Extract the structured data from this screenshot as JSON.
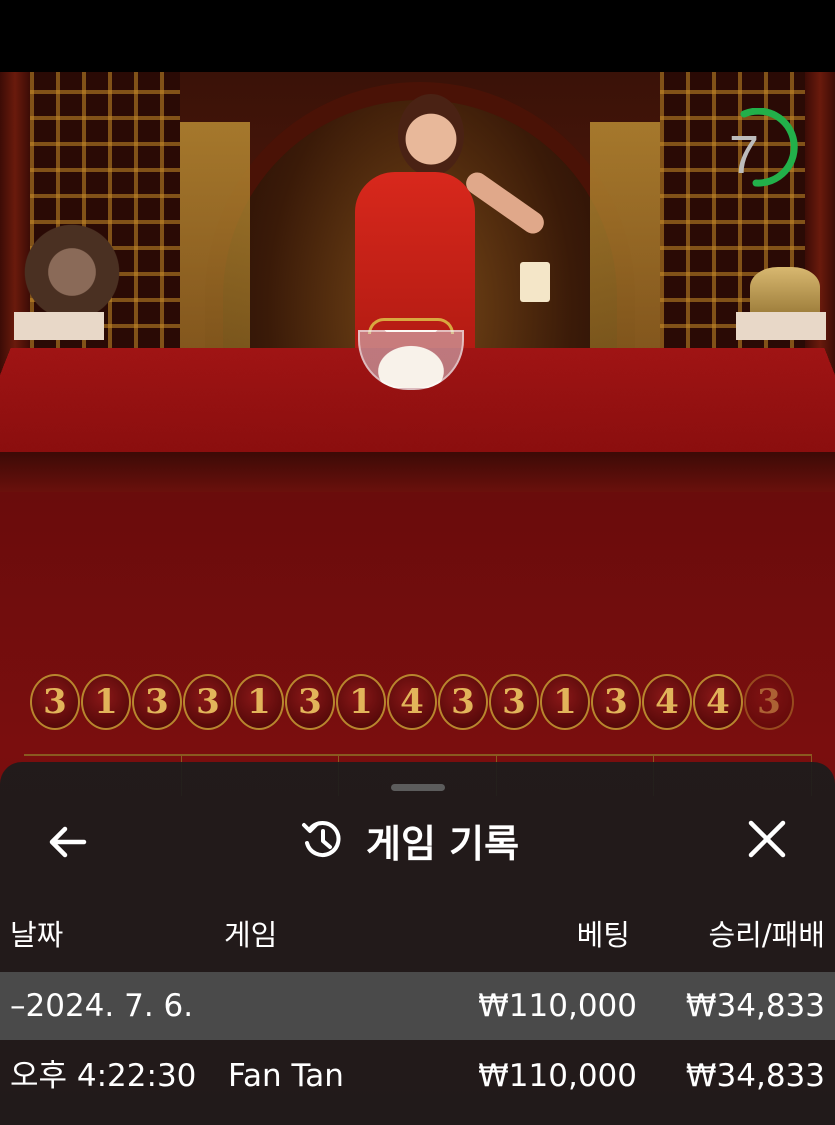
{
  "timer": {
    "value": "7",
    "color": "#22b04a"
  },
  "results": [
    "3",
    "1",
    "3",
    "3",
    "1",
    "3",
    "1",
    "4",
    "3",
    "3",
    "1",
    "3",
    "4",
    "4",
    "3"
  ],
  "sheet": {
    "title": "게임 기록",
    "back_icon": "arrow-left-icon",
    "history_icon": "history-icon",
    "close_icon": "close-icon",
    "columns": {
      "date": "날짜",
      "game": "게임",
      "bet": "베팅",
      "winloss": "승리/패배"
    },
    "date_group": {
      "label": "–2024. 7. 6.",
      "bet": "₩110,000",
      "winloss": "₩34,833"
    },
    "rows": [
      {
        "time": "오후 4:22:30",
        "game": "Fan Tan",
        "bet": "₩110,000",
        "winloss": "₩34,833"
      }
    ]
  }
}
